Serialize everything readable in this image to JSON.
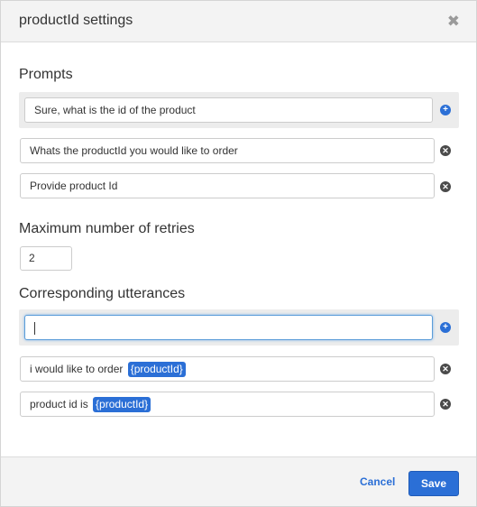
{
  "header": {
    "title": "productId settings",
    "close_glyph": "✖"
  },
  "prompts": {
    "label": "Prompts",
    "items": [
      "Sure, what is the id of the product",
      "Whats the productId you would like to order",
      "Provide product Id"
    ]
  },
  "retries": {
    "label": "Maximum number of retries",
    "value": "2"
  },
  "utterances": {
    "label": "Corresponding utterances",
    "new_value": "",
    "items": [
      {
        "text": "i would like to order",
        "slot": "{productId}"
      },
      {
        "text": "product id is",
        "slot": "{productId}"
      }
    ]
  },
  "footer": {
    "cancel_label": "Cancel",
    "save_label": "Save"
  },
  "icons": {
    "add": "add-circle-icon",
    "remove": "remove-circle-icon",
    "close": "close-icon"
  },
  "colors": {
    "accent": "#2b6fd6",
    "header_bg": "#f3f3f3",
    "slot_bg": "#2b6fd6"
  }
}
